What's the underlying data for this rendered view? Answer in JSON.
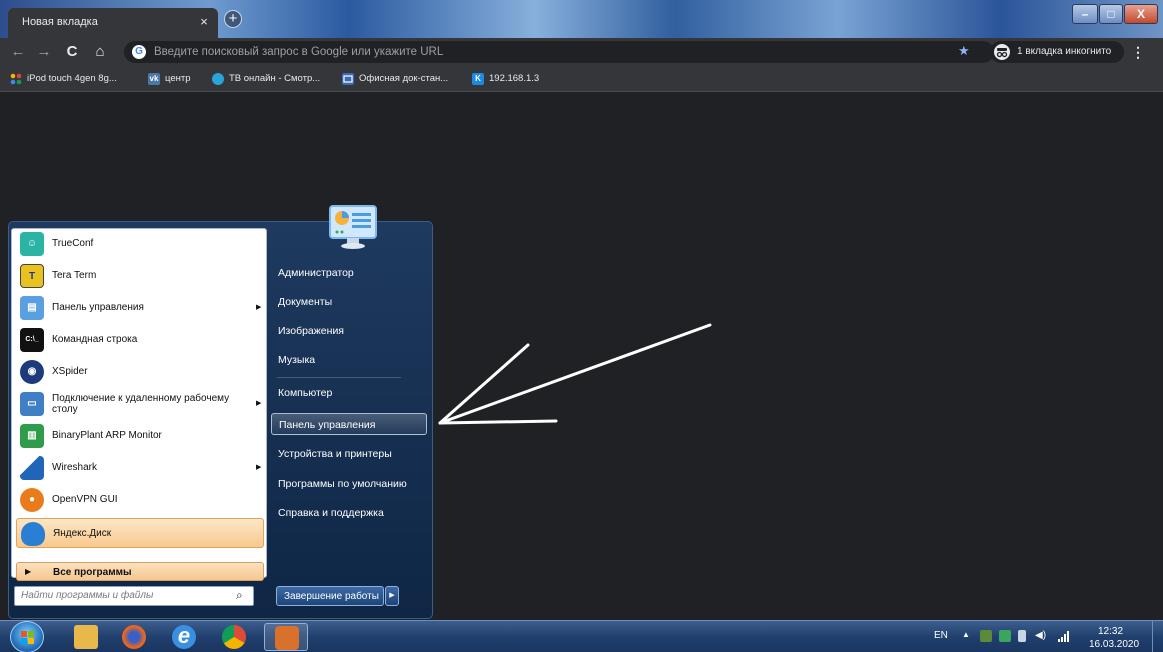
{
  "browser": {
    "tab_title": "Новая вкладка",
    "tab_close": "×",
    "new_tab": "+",
    "window_controls": {
      "minimize": "–",
      "maximize": "□",
      "close": "X"
    },
    "nav": {
      "back": "←",
      "forward": "→",
      "reload": "C",
      "home": "⌂"
    },
    "omnibox": {
      "google_glyph": "G",
      "placeholder": "Введите поисковый запрос в Google или укажите URL"
    },
    "bookmark_star": "★",
    "incognito_label": "1 вкладка инкогнито",
    "menu": "⋮",
    "bookmarks": [
      {
        "label": "iPod touch 4gen 8g...",
        "icon": "multicolor-dots-icon",
        "color": "#f4b400"
      },
      {
        "label": "центр",
        "icon": "vk-icon",
        "color": "#4a76a8",
        "glyph": "vk"
      },
      {
        "label": "ТВ онлайн - Смотр...",
        "icon": "tv-globe-icon",
        "color": "#2aa3d8"
      },
      {
        "label": "Офисная док-стан...",
        "icon": "office-icon",
        "color": "#3b6bb5"
      },
      {
        "label": "192.168.1.3",
        "icon": "k-icon",
        "color": "#1e88e5",
        "glyph": "K"
      }
    ]
  },
  "start_menu": {
    "programs": [
      {
        "label": "TrueConf",
        "icon": "trueconf-icon",
        "color": "#2bb3a3",
        "arrow": false
      },
      {
        "label": "Tera Term",
        "icon": "teraterm-icon",
        "color": "#e9c21f",
        "arrow": false
      },
      {
        "label": "Панель управления",
        "icon": "control-panel-icon",
        "color": "#5aa0e0",
        "arrow": true
      },
      {
        "label": "Командная строка",
        "icon": "cmd-icon",
        "color": "#111111",
        "arrow": false
      },
      {
        "label": "XSpider",
        "icon": "xspider-icon",
        "color": "#1d3a7a",
        "arrow": false
      },
      {
        "label": "Подключение к удаленному рабочему столу",
        "icon": "remote-desktop-icon",
        "color": "#3f7fc6",
        "arrow": true
      },
      {
        "label": "BinaryPlant ARP Monitor",
        "icon": "arp-monitor-icon",
        "color": "#2e9c4a",
        "arrow": false
      },
      {
        "label": "Wireshark",
        "icon": "wireshark-icon",
        "color": "#1f66b8",
        "arrow": true
      },
      {
        "label": "OpenVPN GUI",
        "icon": "openvpn-icon",
        "color": "#ea7b1b",
        "arrow": false
      },
      {
        "label": "Яндекс.Диск",
        "icon": "yandex-disk-icon",
        "color": "#2a7fd4",
        "arrow": false
      }
    ],
    "all_programs": "Все программы",
    "search_placeholder": "Найти программы и файлы",
    "search_icon": "⌕",
    "right_links": [
      "Администратор",
      "Документы",
      "Изображения",
      "Музыка",
      "Компьютер",
      "Панель управления",
      "Устройства и принтеры",
      "Программы по умолчанию",
      "Справка и поддержка"
    ],
    "selected_link": "Панель управления",
    "shutdown": "Завершение работы",
    "shutdown_arrow": "▶"
  },
  "taskbar": {
    "language": "EN",
    "tray_arrow": "▲",
    "time": "12:32",
    "date": "16.03.2020",
    "apps": [
      {
        "name": "explorer",
        "color": "#e8b84a"
      },
      {
        "name": "firefox",
        "color": "#e8661f"
      },
      {
        "name": "internet-explorer",
        "color": "#3a8fe0"
      },
      {
        "name": "chrome",
        "color": "#dd4b39"
      },
      {
        "name": "active-app",
        "color": "#d9702b"
      }
    ]
  }
}
